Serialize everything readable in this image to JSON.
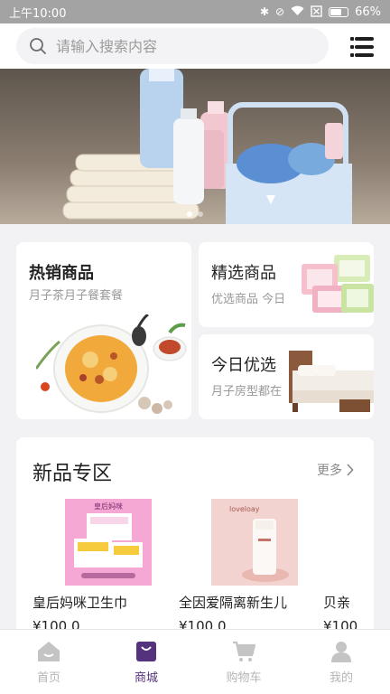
{
  "status_bar": {
    "time": "上午10:00",
    "battery": "66%"
  },
  "search": {
    "placeholder": "请输入搜索内容"
  },
  "banner": {
    "dots": 2,
    "active_dot": 0
  },
  "cards": {
    "hot": {
      "title": "热销商品",
      "subtitle": "月子茶月子餐套餐"
    },
    "selected": {
      "title": "精选商品",
      "subtitle": "优选商品 今日"
    },
    "today": {
      "title": "今日优选",
      "subtitle": "月子房型都在"
    }
  },
  "new_zone": {
    "title": "新品专区",
    "more": "更多",
    "products": [
      {
        "name": "皇后妈咪卫生巾",
        "price": "¥100.0",
        "image_brand": "皇后妈咪"
      },
      {
        "name": "全因爱隔离新生儿",
        "price": "¥100.0",
        "image_brand": "loveloay"
      },
      {
        "name": "贝亲",
        "price": "¥100",
        "image_brand": ""
      }
    ]
  },
  "tabs": [
    {
      "label": "首页",
      "icon": "home-icon",
      "active": false
    },
    {
      "label": "商城",
      "icon": "shopping-bag-icon",
      "active": true
    },
    {
      "label": "购物车",
      "icon": "cart-icon",
      "active": false
    },
    {
      "label": "我的",
      "icon": "user-icon",
      "active": false
    }
  ],
  "colors": {
    "accent": "#55327d",
    "inactive": "#b5b5b5"
  }
}
